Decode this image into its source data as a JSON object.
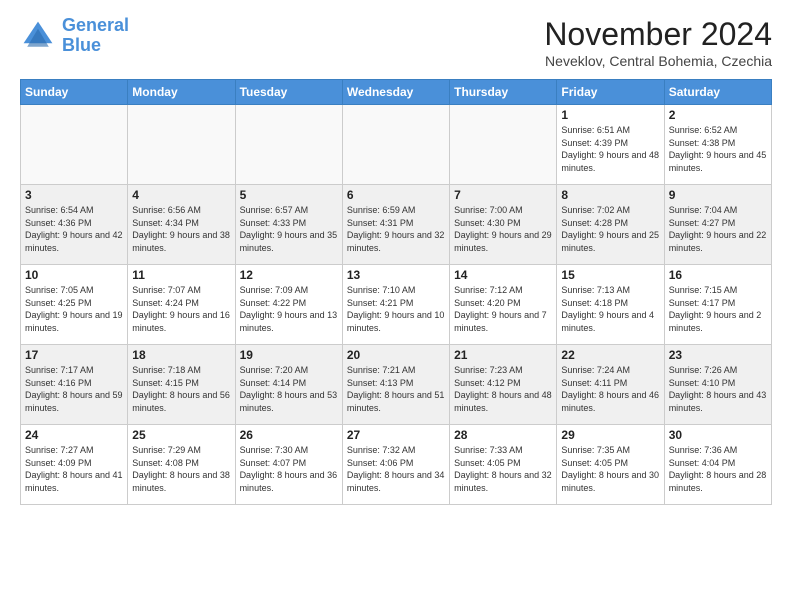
{
  "header": {
    "logo_line1": "General",
    "logo_line2": "Blue",
    "month_title": "November 2024",
    "subtitle": "Neveklov, Central Bohemia, Czechia"
  },
  "weekdays": [
    "Sunday",
    "Monday",
    "Tuesday",
    "Wednesday",
    "Thursday",
    "Friday",
    "Saturday"
  ],
  "weeks": [
    [
      {
        "day": "",
        "info": ""
      },
      {
        "day": "",
        "info": ""
      },
      {
        "day": "",
        "info": ""
      },
      {
        "day": "",
        "info": ""
      },
      {
        "day": "",
        "info": ""
      },
      {
        "day": "1",
        "info": "Sunrise: 6:51 AM\nSunset: 4:39 PM\nDaylight: 9 hours and 48 minutes."
      },
      {
        "day": "2",
        "info": "Sunrise: 6:52 AM\nSunset: 4:38 PM\nDaylight: 9 hours and 45 minutes."
      }
    ],
    [
      {
        "day": "3",
        "info": "Sunrise: 6:54 AM\nSunset: 4:36 PM\nDaylight: 9 hours and 42 minutes."
      },
      {
        "day": "4",
        "info": "Sunrise: 6:56 AM\nSunset: 4:34 PM\nDaylight: 9 hours and 38 minutes."
      },
      {
        "day": "5",
        "info": "Sunrise: 6:57 AM\nSunset: 4:33 PM\nDaylight: 9 hours and 35 minutes."
      },
      {
        "day": "6",
        "info": "Sunrise: 6:59 AM\nSunset: 4:31 PM\nDaylight: 9 hours and 32 minutes."
      },
      {
        "day": "7",
        "info": "Sunrise: 7:00 AM\nSunset: 4:30 PM\nDaylight: 9 hours and 29 minutes."
      },
      {
        "day": "8",
        "info": "Sunrise: 7:02 AM\nSunset: 4:28 PM\nDaylight: 9 hours and 25 minutes."
      },
      {
        "day": "9",
        "info": "Sunrise: 7:04 AM\nSunset: 4:27 PM\nDaylight: 9 hours and 22 minutes."
      }
    ],
    [
      {
        "day": "10",
        "info": "Sunrise: 7:05 AM\nSunset: 4:25 PM\nDaylight: 9 hours and 19 minutes."
      },
      {
        "day": "11",
        "info": "Sunrise: 7:07 AM\nSunset: 4:24 PM\nDaylight: 9 hours and 16 minutes."
      },
      {
        "day": "12",
        "info": "Sunrise: 7:09 AM\nSunset: 4:22 PM\nDaylight: 9 hours and 13 minutes."
      },
      {
        "day": "13",
        "info": "Sunrise: 7:10 AM\nSunset: 4:21 PM\nDaylight: 9 hours and 10 minutes."
      },
      {
        "day": "14",
        "info": "Sunrise: 7:12 AM\nSunset: 4:20 PM\nDaylight: 9 hours and 7 minutes."
      },
      {
        "day": "15",
        "info": "Sunrise: 7:13 AM\nSunset: 4:18 PM\nDaylight: 9 hours and 4 minutes."
      },
      {
        "day": "16",
        "info": "Sunrise: 7:15 AM\nSunset: 4:17 PM\nDaylight: 9 hours and 2 minutes."
      }
    ],
    [
      {
        "day": "17",
        "info": "Sunrise: 7:17 AM\nSunset: 4:16 PM\nDaylight: 8 hours and 59 minutes."
      },
      {
        "day": "18",
        "info": "Sunrise: 7:18 AM\nSunset: 4:15 PM\nDaylight: 8 hours and 56 minutes."
      },
      {
        "day": "19",
        "info": "Sunrise: 7:20 AM\nSunset: 4:14 PM\nDaylight: 8 hours and 53 minutes."
      },
      {
        "day": "20",
        "info": "Sunrise: 7:21 AM\nSunset: 4:13 PM\nDaylight: 8 hours and 51 minutes."
      },
      {
        "day": "21",
        "info": "Sunrise: 7:23 AM\nSunset: 4:12 PM\nDaylight: 8 hours and 48 minutes."
      },
      {
        "day": "22",
        "info": "Sunrise: 7:24 AM\nSunset: 4:11 PM\nDaylight: 8 hours and 46 minutes."
      },
      {
        "day": "23",
        "info": "Sunrise: 7:26 AM\nSunset: 4:10 PM\nDaylight: 8 hours and 43 minutes."
      }
    ],
    [
      {
        "day": "24",
        "info": "Sunrise: 7:27 AM\nSunset: 4:09 PM\nDaylight: 8 hours and 41 minutes."
      },
      {
        "day": "25",
        "info": "Sunrise: 7:29 AM\nSunset: 4:08 PM\nDaylight: 8 hours and 38 minutes."
      },
      {
        "day": "26",
        "info": "Sunrise: 7:30 AM\nSunset: 4:07 PM\nDaylight: 8 hours and 36 minutes."
      },
      {
        "day": "27",
        "info": "Sunrise: 7:32 AM\nSunset: 4:06 PM\nDaylight: 8 hours and 34 minutes."
      },
      {
        "day": "28",
        "info": "Sunrise: 7:33 AM\nSunset: 4:05 PM\nDaylight: 8 hours and 32 minutes."
      },
      {
        "day": "29",
        "info": "Sunrise: 7:35 AM\nSunset: 4:05 PM\nDaylight: 8 hours and 30 minutes."
      },
      {
        "day": "30",
        "info": "Sunrise: 7:36 AM\nSunset: 4:04 PM\nDaylight: 8 hours and 28 minutes."
      }
    ]
  ]
}
